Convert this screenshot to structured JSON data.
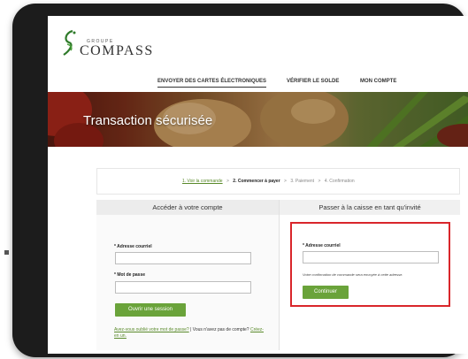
{
  "logo": {
    "group_label": "GROUPE",
    "name": "COMPASS"
  },
  "nav": {
    "items": [
      {
        "label": "ENVOYER DES CARTES ÉLECTRONIQUES",
        "active": true
      },
      {
        "label": "VÉRIFIER LE SOLDE",
        "active": false
      },
      {
        "label": "MON COMPTE",
        "active": false
      }
    ]
  },
  "banner": {
    "title": "Transaction sécurisée"
  },
  "steps": {
    "step1": "1. Voir la commande",
    "sep1": ">",
    "step2": "2. Commencer à payer",
    "sep2": ">",
    "step3": "3. Paiement",
    "sep3": ">",
    "step4": "4. Confirmation"
  },
  "login_panel": {
    "heading": "Accéder à votre compte",
    "email_label": "* Adresse courriel",
    "email_value": "",
    "password_label": "* Mot de passe",
    "password_value": "",
    "login_button": "Ouvrir une session",
    "forgot_link": "Avez-vous oublié votre mot de passe?",
    "separator": "|",
    "no_account": "Vous n'avez pas de compte?",
    "create_link": "Créez-en un."
  },
  "guest_panel": {
    "heading": "Passer à la caisse en tant qu'invité",
    "email_label": "* Adresse courriel",
    "email_value": "",
    "note": "Votre confirmation de commande sera envoyée à cette adresse.",
    "continue_button": "Continuer"
  },
  "colors": {
    "accent_green": "#6aa33a",
    "highlight_red": "#d9262b"
  }
}
